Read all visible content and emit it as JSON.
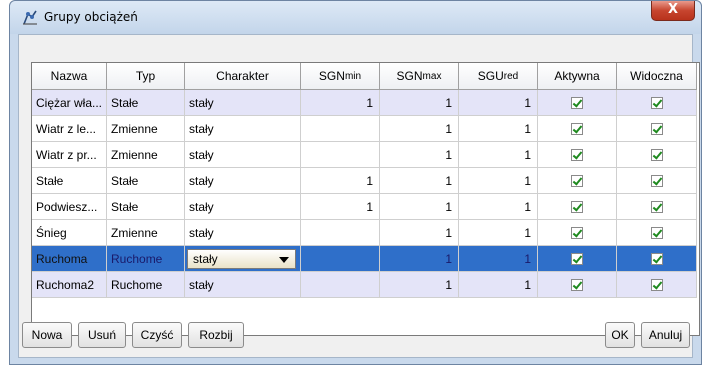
{
  "window": {
    "title": "Grupy obciążeń",
    "close_label": "X"
  },
  "columns": [
    "Nazwa",
    "Typ",
    "Charakter",
    "SGN",
    "SGN",
    "SGU",
    "Aktywna",
    "Widoczna"
  ],
  "column_subscripts": [
    "",
    "",
    "",
    "min",
    "max",
    "red",
    "",
    ""
  ],
  "rows": [
    {
      "name": "Ciężar wła...",
      "typ": "Stałe",
      "charakter": "stały",
      "sgn_min": "1",
      "sgn_max": "1",
      "sgu_red": "1",
      "aktywna": true,
      "widoczna": true
    },
    {
      "name": "Wiatr z le...",
      "typ": "Zmienne",
      "charakter": "stały",
      "sgn_min": "",
      "sgn_max": "1",
      "sgu_red": "1",
      "aktywna": true,
      "widoczna": true
    },
    {
      "name": "Wiatr z pr...",
      "typ": "Zmienne",
      "charakter": "stały",
      "sgn_min": "",
      "sgn_max": "1",
      "sgu_red": "1",
      "aktywna": true,
      "widoczna": true
    },
    {
      "name": "Stałe",
      "typ": "Stałe",
      "charakter": "stały",
      "sgn_min": "1",
      "sgn_max": "1",
      "sgu_red": "1",
      "aktywna": true,
      "widoczna": true
    },
    {
      "name": "Podwiesz...",
      "typ": "Stałe",
      "charakter": "stały",
      "sgn_min": "1",
      "sgn_max": "1",
      "sgu_red": "1",
      "aktywna": true,
      "widoczna": true
    },
    {
      "name": "Śnieg",
      "typ": "Zmienne",
      "charakter": "stały",
      "sgn_min": "",
      "sgn_max": "1",
      "sgu_red": "1",
      "aktywna": true,
      "widoczna": true
    },
    {
      "name": "Ruchoma",
      "typ": "Ruchome",
      "charakter": "stały",
      "sgn_min": "",
      "sgn_max": "1",
      "sgu_red": "1",
      "aktywna": true,
      "widoczna": true
    },
    {
      "name": "Ruchoma2",
      "typ": "Ruchome",
      "charakter": "stały",
      "sgn_min": "",
      "sgn_max": "1",
      "sgu_red": "1",
      "aktywna": true,
      "widoczna": true
    }
  ],
  "buttons": {
    "nowa": "Nowa",
    "usun": "Usuń",
    "czysc": "Czyść",
    "rozbij": "Rozbij",
    "ok": "OK",
    "anuluj": "Anuluj"
  },
  "colors": {
    "selected_row": "#2f6fc9",
    "lavender_row": "#e4e4f8",
    "check": "#1f8a1f"
  }
}
